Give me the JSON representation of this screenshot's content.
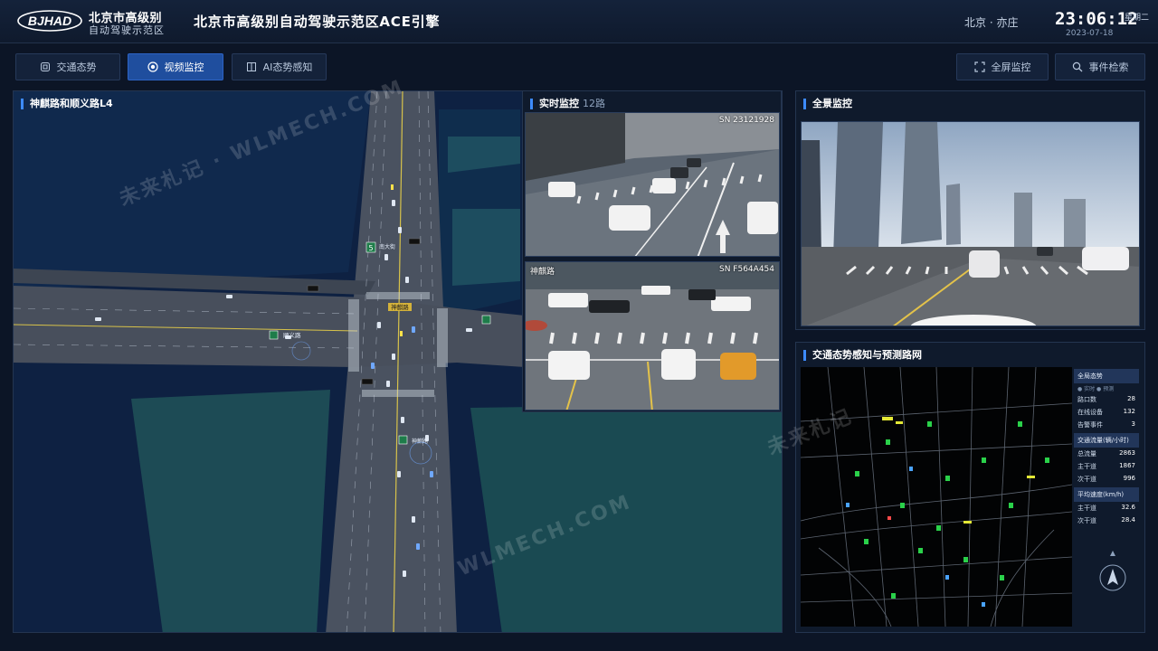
{
  "header": {
    "logo_text": "BJHAD",
    "brand_line1": "北京市高级别",
    "brand_line2": "自动驾驶示范区",
    "title": "北京市高级别自动驾驶示范区ACE引擎",
    "location": "北京 · 亦庄",
    "time": "23:06:12",
    "date": "2023-07-18",
    "weekday": "星期二"
  },
  "toolbar": {
    "traffic_label": "交通态势",
    "video_label": "视频监控",
    "ai_label": "AI态势感知",
    "fullscreen_label": "全屏监控",
    "search_label": "事件检索"
  },
  "map_panel": {
    "title": "神麒路和顺义路L4",
    "road_label_1": "神麒路",
    "road_label_2": "顺义路",
    "road_label_3": "神麒路",
    "road_label_4": "南大街",
    "sign_number": "5"
  },
  "realtime_panel": {
    "title": "实时监控",
    "sub": "12路",
    "feed1_sn": "SN 23121928",
    "feed2_sn": "SN F564A454",
    "feed2_road": "神麒路"
  },
  "panorama_panel": {
    "title": "全景监控"
  },
  "network_panel": {
    "title": "交通态势感知与预测路网",
    "stats": {
      "overall_title": "全局态势",
      "overall_sub": "● 实时 ● 预测",
      "rows1": [
        {
          "label": "路口数",
          "value": "28"
        },
        {
          "label": "在线设备",
          "value": "132"
        },
        {
          "label": "告警事件",
          "value": "3"
        }
      ],
      "flow_title": "交通流量(辆/小时)",
      "rows2": [
        {
          "label": "总流量",
          "value": "2863"
        },
        {
          "label": "主干道",
          "value": "1867"
        },
        {
          "label": "次干道",
          "value": "996"
        }
      ],
      "speed_title": "平均速度(km/h)",
      "rows3": [
        {
          "label": "主干道",
          "value": "32.6"
        },
        {
          "label": "次干道",
          "value": "28.4"
        }
      ]
    }
  },
  "watermarks": [
    "未来札记 · WLMECH.COM",
    "WLMECH.COM",
    "未来札记"
  ]
}
